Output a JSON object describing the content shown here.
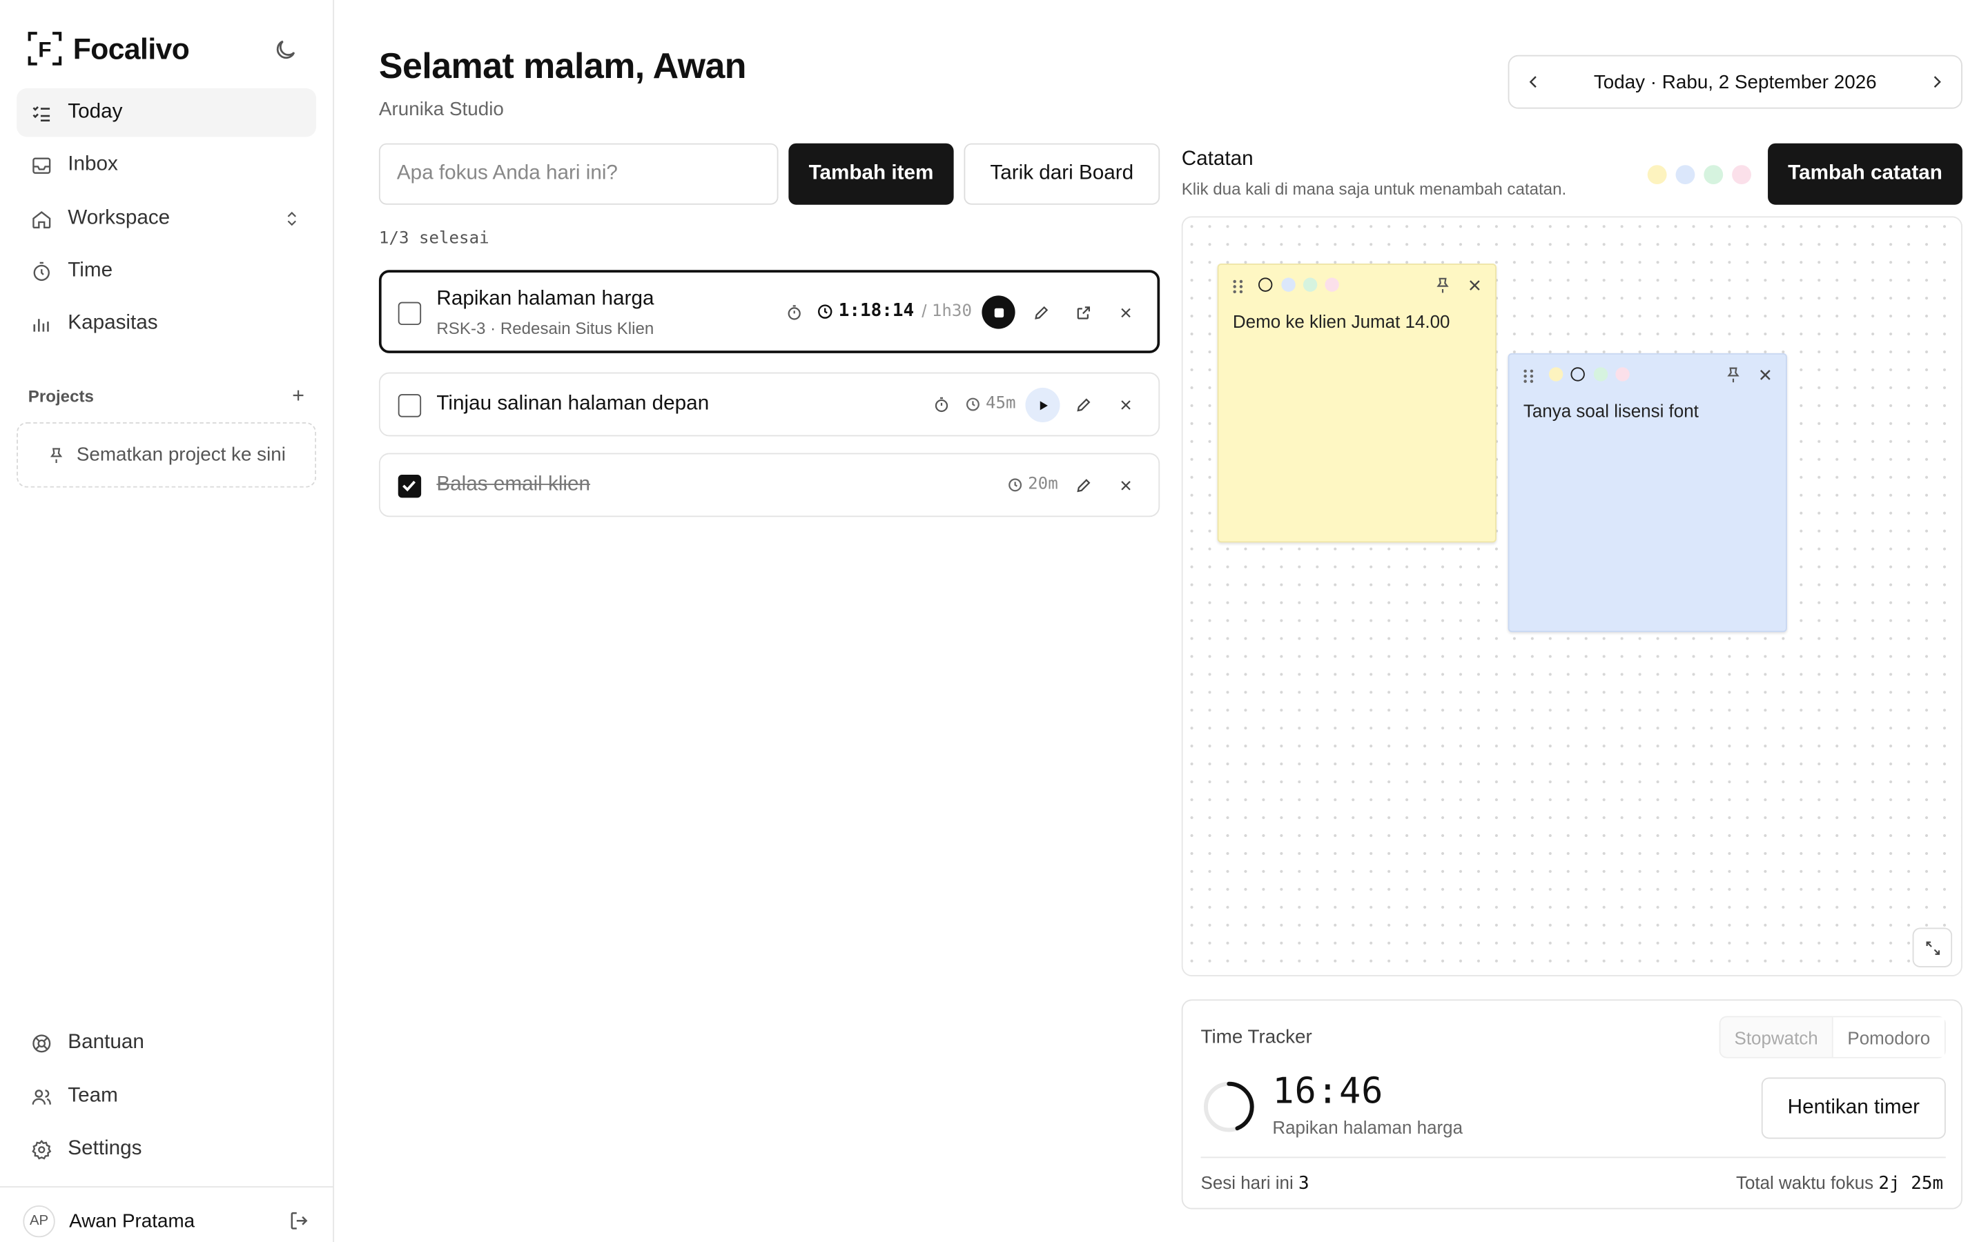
{
  "app": {
    "name": "Focalivo",
    "logo_letter": "F"
  },
  "sidebar": {
    "nav": [
      {
        "label": "Today",
        "icon": "list-check-icon",
        "active": true
      },
      {
        "label": "Inbox",
        "icon": "inbox-icon"
      },
      {
        "label": "Workspace",
        "icon": "home-icon",
        "expandable": true
      },
      {
        "label": "Time",
        "icon": "stopwatch-icon"
      },
      {
        "label": "Kapasitas",
        "icon": "bar-chart-icon"
      }
    ],
    "projects_label": "Projects",
    "pin_text": "Sematkan project ke sini",
    "bottom": [
      {
        "label": "Bantuan",
        "icon": "lifebuoy-icon"
      },
      {
        "label": "Team",
        "icon": "users-icon"
      },
      {
        "label": "Settings",
        "icon": "gear-icon"
      }
    ],
    "user": {
      "initials": "AP",
      "name": "Awan Pratama"
    }
  },
  "header": {
    "greeting": "Selamat malam, Awan",
    "workspace": "Arunika Studio",
    "date_label": "Today · Rabu, 2 September 2026"
  },
  "focus": {
    "placeholder": "Apa fokus Anda hari ini?",
    "add_button": "Tambah item",
    "pull_button": "Tarik dari Board",
    "progress": "1/3 selesai"
  },
  "tasks": [
    {
      "title": "Rapikan halaman harga",
      "subtitle": "RSK-3 · Redesain Situs Klien",
      "elapsed": "1:18:14",
      "separator": "/",
      "estimate": "1h30",
      "running": true,
      "done": false
    },
    {
      "title": "Tinjau salinan halaman depan",
      "estimate": "45m",
      "running": false,
      "done": false
    },
    {
      "title": "Balas email klien",
      "estimate": "20m",
      "done": true
    }
  ],
  "notes": {
    "title": "Catatan",
    "hint": "Klik dua kali di mana saja untuk menambah catatan.",
    "add_button": "Tambah catatan",
    "palette": [
      "#fdf3bf",
      "#dbe7fb",
      "#d6f3df",
      "#fbe0ea"
    ],
    "items": [
      {
        "text": "Demo ke klien Jumat 14.00",
        "color": "#fef7c3"
      },
      {
        "text": "Tanya soal lisensi font",
        "color": "#dbe7fb"
      }
    ]
  },
  "tracker": {
    "title": "Time Tracker",
    "modes": [
      "Stopwatch",
      "Pomodoro"
    ],
    "active_mode": "Pomodoro",
    "time": "16:46",
    "task": "Rapikan halaman harga",
    "stop_button": "Hentikan timer",
    "sessions_label": "Sesi hari ini",
    "sessions_value": "3",
    "total_label": "Total waktu fokus",
    "total_value": "2j 25m"
  }
}
